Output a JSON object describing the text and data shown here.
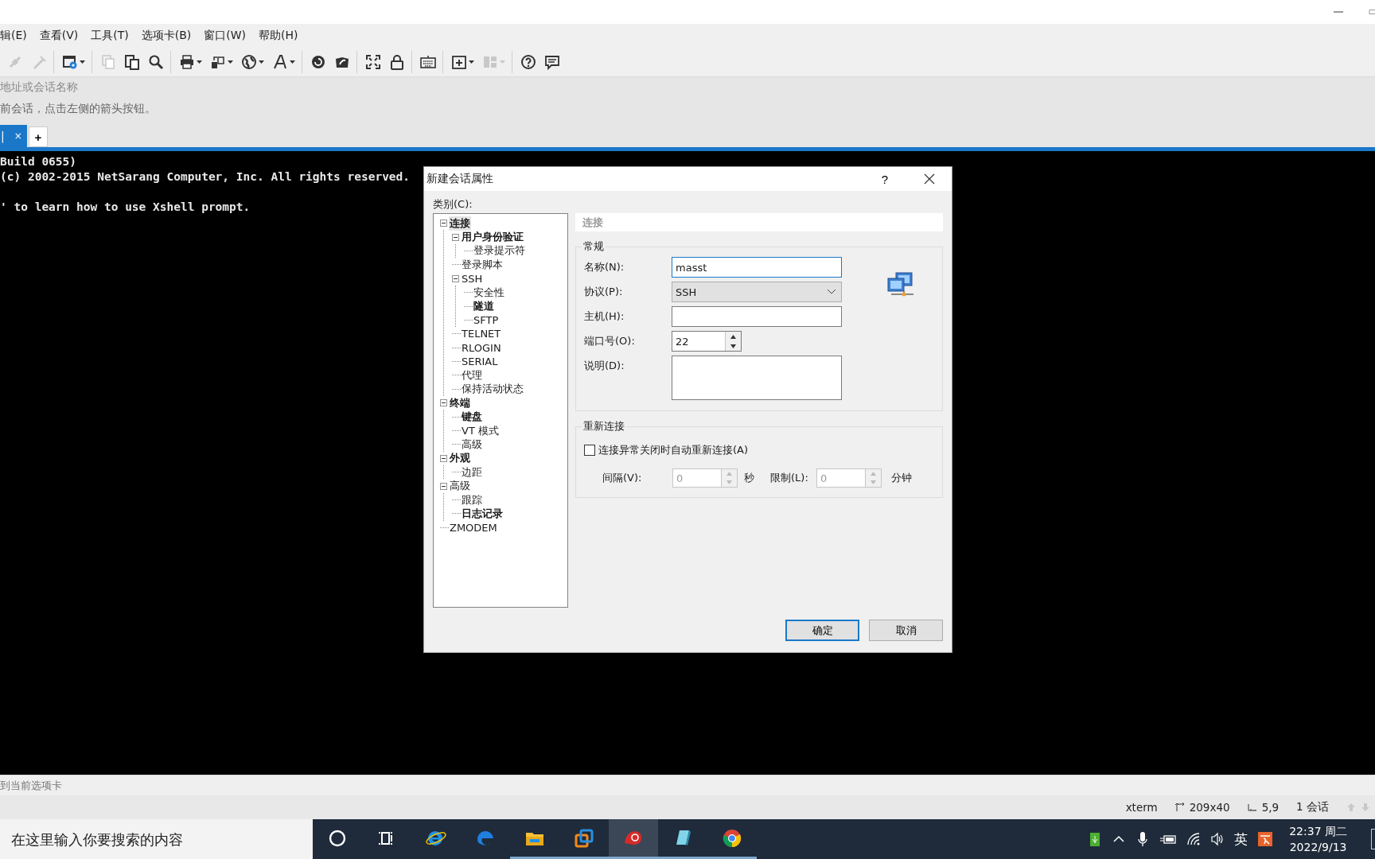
{
  "menu": [
    "辑(E)",
    "查看(V)",
    "工具(T)",
    "选项卡(B)",
    "窗口(W)",
    "帮助(H)"
  ],
  "toolbar": [
    {
      "disabled": true,
      "dropdown": false,
      "separator_after": false
    },
    {
      "disabled": true,
      "dropdown": false,
      "separator_after": true
    },
    {
      "disabled": false,
      "dropdown": true,
      "separator_after": true
    },
    {
      "disabled": true,
      "dropdown": false,
      "separator_after": false
    },
    {
      "disabled": false,
      "dropdown": false,
      "separator_after": false
    },
    {
      "disabled": false,
      "dropdown": false,
      "separator_after": true
    },
    {
      "disabled": false,
      "dropdown": true,
      "separator_after": false
    },
    {
      "disabled": false,
      "dropdown": true,
      "separator_after": false
    },
    {
      "disabled": false,
      "dropdown": true,
      "separator_after": false
    },
    {
      "disabled": false,
      "dropdown": true,
      "separator_after": true
    },
    {
      "disabled": false,
      "dropdown": false,
      "separator_after": false
    },
    {
      "disabled": false,
      "dropdown": false,
      "separator_after": true
    },
    {
      "disabled": false,
      "dropdown": false,
      "separator_after": false
    },
    {
      "disabled": false,
      "dropdown": false,
      "separator_after": true
    },
    {
      "disabled": false,
      "dropdown": false,
      "separator_after": true
    },
    {
      "disabled": false,
      "dropdown": true,
      "separator_after": false
    },
    {
      "disabled": true,
      "dropdown": true,
      "separator_after": true
    },
    {
      "disabled": false,
      "dropdown": false,
      "separator_after": false
    },
    {
      "disabled": false,
      "dropdown": false,
      "separator_after": false
    }
  ],
  "address_bar": {
    "placeholder": "地址或会话名称"
  },
  "notice": "前会话，点击左侧的箭头按钮。",
  "tabs": [
    {
      "label": "|",
      "selected": true,
      "close": "×"
    }
  ],
  "new_tab": "+",
  "terminal": {
    "header": [
      "Build 0655)",
      "(c) 2002-2015 NetSarang Computer, Inc. All rights reserved."
    ],
    "body": [
      "' to learn how to use Xshell prompt."
    ]
  },
  "dialog": {
    "title": "新建会话属性",
    "help": "?",
    "category_label": "类别(C):",
    "tree": [
      {
        "label": "连接",
        "bold": true,
        "selected": true,
        "expanded": true,
        "children": [
          {
            "label": "用户身份验证",
            "bold": true,
            "selected": false,
            "expanded": true,
            "children": [
              {
                "label": "登录提示符",
                "bold": false,
                "selected": false
              }
            ]
          },
          {
            "label": "登录脚本",
            "bold": false,
            "selected": false
          },
          {
            "label": "SSH",
            "bold": false,
            "selected": false,
            "expanded": true,
            "children": [
              {
                "label": "安全性",
                "bold": false,
                "selected": false
              },
              {
                "label": "隧道",
                "bold": true,
                "selected": false
              },
              {
                "label": "SFTP",
                "bold": false,
                "selected": false
              }
            ]
          },
          {
            "label": "TELNET",
            "bold": false,
            "selected": false
          },
          {
            "label": "RLOGIN",
            "bold": false,
            "selected": false
          },
          {
            "label": "SERIAL",
            "bold": false,
            "selected": false
          },
          {
            "label": "代理",
            "bold": false,
            "selected": false
          },
          {
            "label": "保持活动状态",
            "bold": false,
            "selected": false
          }
        ]
      },
      {
        "label": "终端",
        "bold": true,
        "selected": false,
        "expanded": true,
        "children": [
          {
            "label": "键盘",
            "bold": true,
            "selected": false
          },
          {
            "label": "VT 模式",
            "bold": false,
            "selected": false
          },
          {
            "label": "高级",
            "bold": false,
            "selected": false
          }
        ]
      },
      {
        "label": "外观",
        "bold": true,
        "selected": false,
        "expanded": true,
        "children": [
          {
            "label": "边距",
            "bold": false,
            "selected": false
          }
        ]
      },
      {
        "label": "高级",
        "bold": false,
        "selected": false,
        "expanded": true,
        "children": [
          {
            "label": "跟踪",
            "bold": false,
            "selected": false
          },
          {
            "label": "日志记录",
            "bold": true,
            "selected": false
          }
        ]
      },
      {
        "label": "ZMODEM",
        "bold": false,
        "selected": false
      }
    ],
    "section_title": "连接",
    "general": {
      "title": "常规",
      "fields": [
        {
          "kind": "text",
          "label": "名称(N):",
          "value": "masst",
          "focused": true
        },
        {
          "kind": "select",
          "label": "协议(P):",
          "value": "SSH",
          "focused": false
        },
        {
          "kind": "text",
          "label": "主机(H):",
          "focused": false
        },
        {
          "kind": "spin",
          "label": "端口号(O):",
          "value": "22",
          "focused": false
        },
        {
          "kind": "textarea",
          "label": "说明(D):",
          "focused": false
        }
      ]
    },
    "reconnect": {
      "title": "重新连接",
      "checkbox": {
        "label": "连接异常关闭时自动重新连接(A)",
        "checked": false
      },
      "interval": {
        "label": "间隔(V):",
        "value": "0",
        "unit": "秒",
        "disabled": true
      },
      "limit": {
        "label": "限制(L):",
        "value": "0",
        "unit": "分钟",
        "disabled": true
      }
    },
    "buttons": [
      {
        "label": "确定",
        "default": true
      },
      {
        "label": "取消",
        "default": false
      }
    ]
  },
  "input_bar": {
    "text": "到当前选项卡"
  },
  "status_bar": {
    "terminal_type": "xterm",
    "size": "209x40",
    "cursor": "5,9",
    "sessions": "1 会话"
  },
  "taskbar": {
    "search": {
      "placeholder": "在这里输入你要搜索的内容"
    },
    "apps": [
      {
        "running": false,
        "selected": false
      },
      {
        "running": false,
        "selected": false
      },
      {
        "running": false,
        "selected": false
      },
      {
        "running": true,
        "selected": false
      },
      {
        "running": true,
        "selected": false
      },
      {
        "running": true,
        "selected": true
      },
      {
        "running": true,
        "selected": false
      },
      {
        "running": true,
        "selected": false
      }
    ],
    "ime": "英",
    "time": "22:37 周二",
    "date": "2022/9/13"
  }
}
